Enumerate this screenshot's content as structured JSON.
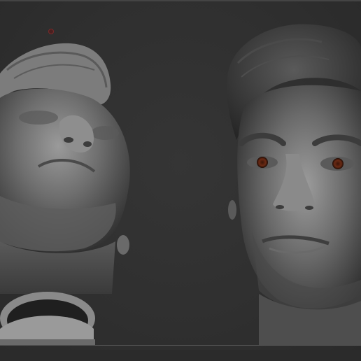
{
  "viewport": {
    "background": "#2e2e2e",
    "models": [
      {
        "name": "head-upward-view",
        "material": "matcap-gray"
      },
      {
        "name": "head-front-view",
        "material": "matcap-gray"
      }
    ],
    "marker_color": "#7a2a2a"
  }
}
